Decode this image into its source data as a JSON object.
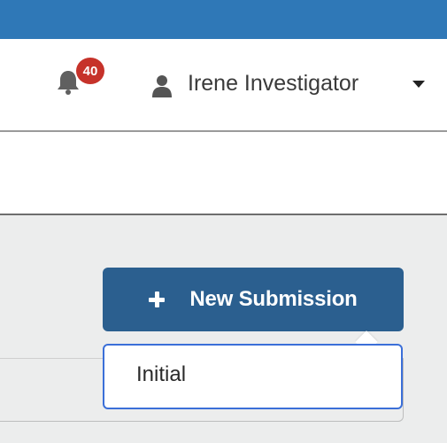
{
  "header": {
    "notifications": {
      "icon": "bell-icon",
      "count": "40",
      "badge_color": "#c6322a"
    },
    "user_menu": {
      "icon": "user-icon",
      "name": "Irene Investigator",
      "caret_icon": "caret-down-icon"
    }
  },
  "colors": {
    "top_bar": "#2f78b7",
    "primary_button": "#2b5f8f",
    "dropdown_border": "#3b6fd8"
  },
  "actions": {
    "new_submission": {
      "icon": "plus-icon",
      "label": "New Submission"
    }
  },
  "dropdown": {
    "items": [
      {
        "label": "Initial"
      }
    ]
  }
}
